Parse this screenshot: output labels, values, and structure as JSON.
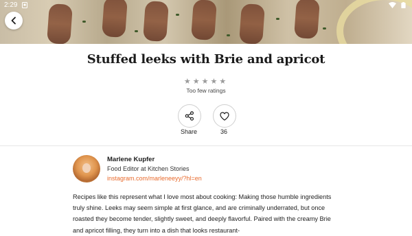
{
  "status_bar": {
    "time": "2:29",
    "icons": [
      "notification-icon",
      "wifi-icon",
      "battery-icon"
    ]
  },
  "hero": {
    "image": "stuffed-leeks-photo"
  },
  "recipe": {
    "title": "Stuffed leeks with Brie and apricot",
    "rating_stars": 5,
    "rating_value": 0,
    "rating_text": "Too few ratings"
  },
  "actions": {
    "share_label": "Share",
    "like_count": "36"
  },
  "author": {
    "name": "Marlene Kupfer",
    "role": "Food Editor at Kitchen Stories",
    "link": "instagram.com/marleneeyy/?hl=en"
  },
  "description": "Recipes like this represent what I love most about cooking: Making those humble ingredients truly shine. Leeks may seem simple at first glance, and are criminally underrated, but once roasted they become tender, slightly sweet, and deeply flavorful. Paired with the creamy Brie and apricot filling, they turn into a dish that looks restaurant-",
  "colors": {
    "accent": "#e86a2c",
    "text": "#1f1f1f",
    "star_empty": "#9a9a9a"
  }
}
